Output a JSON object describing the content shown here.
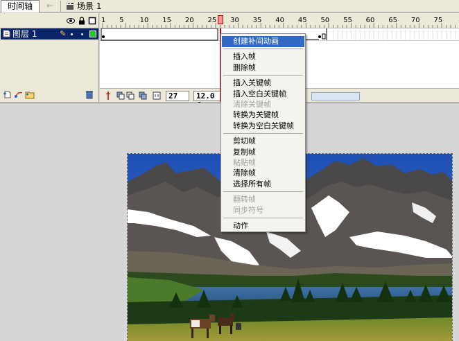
{
  "window": {
    "timeline_tab": "时间轴",
    "scene_label": "场景 1"
  },
  "layers": [
    {
      "name": "图层 1",
      "selected": true,
      "color": "#22cc22"
    }
  ],
  "icons": {
    "back": "back-arrow-icon",
    "scene": "scene-clapper-icon",
    "eye": "eye-icon",
    "lock": "lock-icon",
    "outline": "outline-square-icon",
    "layer": "layer-page-icon",
    "pencil": "pencil-icon",
    "insert_layer": "insert-layer-icon",
    "motion_guide": "motion-guide-icon",
    "insert_folder": "insert-folder-icon",
    "delete_layer": "trash-icon",
    "center_frame": "center-frame-icon",
    "onion_skin": "onion-skin-icon",
    "onion_outline": "onion-skin-outlines-icon",
    "edit_multiple": "edit-multiple-frames-icon",
    "modify_markers": "modify-onion-markers-icon"
  },
  "ruler": {
    "labels": [
      "1",
      "5",
      "10",
      "15",
      "20",
      "25",
      "30",
      "35",
      "40",
      "45",
      "50",
      "55",
      "60",
      "65",
      "70",
      "75",
      "8"
    ]
  },
  "status": {
    "current_frame": "27",
    "frame_rate": "12.0 f"
  },
  "colors": {
    "selection": "#0a246a",
    "menu_highlight": "#316ac5",
    "playhead": "#cc0000",
    "stage": "#d6d6d6"
  },
  "context_menu": {
    "groups": [
      [
        {
          "label": "创建补间动画",
          "highlighted": true
        }
      ],
      [
        {
          "label": "插入帧"
        },
        {
          "label": "删除帧"
        }
      ],
      [
        {
          "label": "插入关键帧"
        },
        {
          "label": "插入空白关键帧"
        },
        {
          "label": "清除关键帧",
          "disabled": true
        },
        {
          "label": "转换为关键帧"
        },
        {
          "label": "转换为空白关键帧"
        }
      ],
      [
        {
          "label": "剪切帧"
        },
        {
          "label": "复制帧"
        },
        {
          "label": "粘贴帧",
          "disabled": true
        },
        {
          "label": "清除帧"
        },
        {
          "label": "选择所有帧"
        }
      ],
      [
        {
          "label": "翻转帧",
          "disabled": true
        },
        {
          "label": "同步符号",
          "disabled": true
        }
      ],
      [
        {
          "label": "动作"
        }
      ]
    ]
  }
}
